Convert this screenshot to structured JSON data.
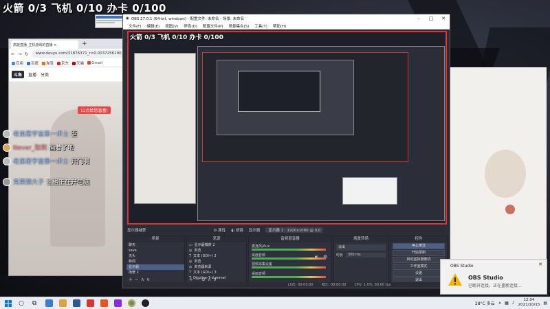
{
  "overlay": {
    "text": "火箭 0/3 飞机 0/10 办卡 0/100"
  },
  "browser": {
    "tab_title": "高能直播_主机游戏的直播 ×",
    "url": "www.douyu.com/31876371_r=0.0037256190",
    "bookmarks": [
      "应用",
      "百度",
      "淘宝",
      "京东",
      "天猫",
      "Gmail"
    ],
    "site_nav": [
      "斗鱼",
      "直播",
      "分类"
    ],
    "gift_hint": "12点给您盲盒!"
  },
  "chat": [
    {
      "name": "老弟是宇宙第一术士",
      "message": "歪"
    },
    {
      "name": "Never_取刷",
      "message": "画着了吧"
    },
    {
      "name": "老弟是宇宙第一术士",
      "message": "开门啊"
    },
    {
      "name": "克莱德大子",
      "message": "主播正在开电脑"
    }
  ],
  "obs": {
    "window_title": "OBS 27.0.1 (64-bit, windows) - 配置文件: 未命名 - 场景: 未命名",
    "menu": [
      "文件(F)",
      "编辑(E)",
      "视图(V)",
      "停靠(D)",
      "配置文件(P)",
      "场景集合(S)",
      "工具(T)",
      "帮助(H)"
    ],
    "preview_overlay": "火箭 0/3 飞机 0/10 办卡 0/100",
    "dock_bar": {
      "source_label": "显示器捕获",
      "properties": "属性",
      "filters": "滤镜",
      "display_label": "显示器",
      "display_value": "显示器 1 : 1920x1080 @ 0,0"
    },
    "scenes": {
      "title": "场景",
      "items": [
        "聊天",
        "save",
        "无头",
        "新闻",
        "显示器",
        "场景 2"
      ]
    },
    "sources": {
      "title": "来源",
      "items": [
        "显示器捕获 2",
        "浏览",
        "文本 (GDI+) 2",
        "浏览",
        "浏览器来源",
        "文本 (GDI+) 3",
        "Displive-7-dummel",
        "..."
      ]
    },
    "mixer": {
      "title": "音频混音器",
      "channels": [
        {
          "name": "麦克风/Aux",
          "level": "0.0 dB"
        },
        {
          "name": "桌面音频",
          "level": "0.0 dB"
        },
        {
          "name": "视频采集设备",
          "level": "0.0 dB"
        },
        {
          "name": "桌面音频",
          "level": "0.0 dB"
        }
      ]
    },
    "transition": {
      "title": "场景转场",
      "type": "淡出",
      "duration_label": "时长",
      "duration": "300 ms"
    },
    "controls": {
      "title": "控件",
      "buttons": [
        "停止推流",
        "开始录制",
        "启动虚拟摄像机",
        "工作室模式",
        "设置",
        "退出"
      ]
    },
    "status": {
      "live": "LIVE: 00:00:00",
      "rec": "REC: 00:00:00",
      "cpu": "CPU: 1.0%, 60.00 fps"
    }
  },
  "toast": {
    "app": "OBS Studio",
    "title": "OBS Studio",
    "body": "已断开连接。正在重新连接..."
  },
  "taskbar": {
    "weather": "28°C 多云",
    "time": "12:04",
    "date": "2021/10/15"
  },
  "colors": {
    "obs_preview_border": "#d33333",
    "obs_bg": "#2b2e38",
    "toast_warning": "#f5b400"
  }
}
